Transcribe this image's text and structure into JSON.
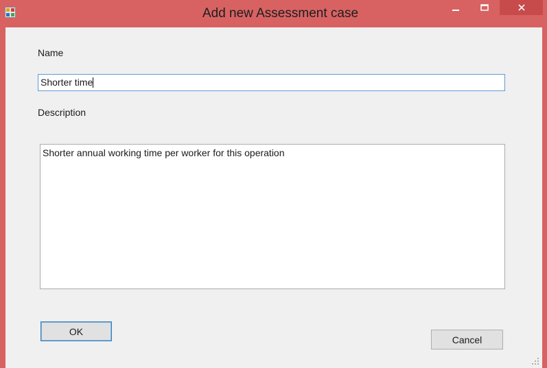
{
  "window": {
    "title": "Add new Assessment case",
    "frame_color": "#d86262",
    "icons": [
      "app-icon",
      "minimize-icon",
      "maximize-icon",
      "close-icon"
    ]
  },
  "form": {
    "name_label": "Name",
    "name_value": "Shorter time",
    "description_label": "Description",
    "description_value": "Shorter annual working time per worker for this operation"
  },
  "buttons": {
    "ok_label": "OK",
    "cancel_label": "Cancel"
  }
}
